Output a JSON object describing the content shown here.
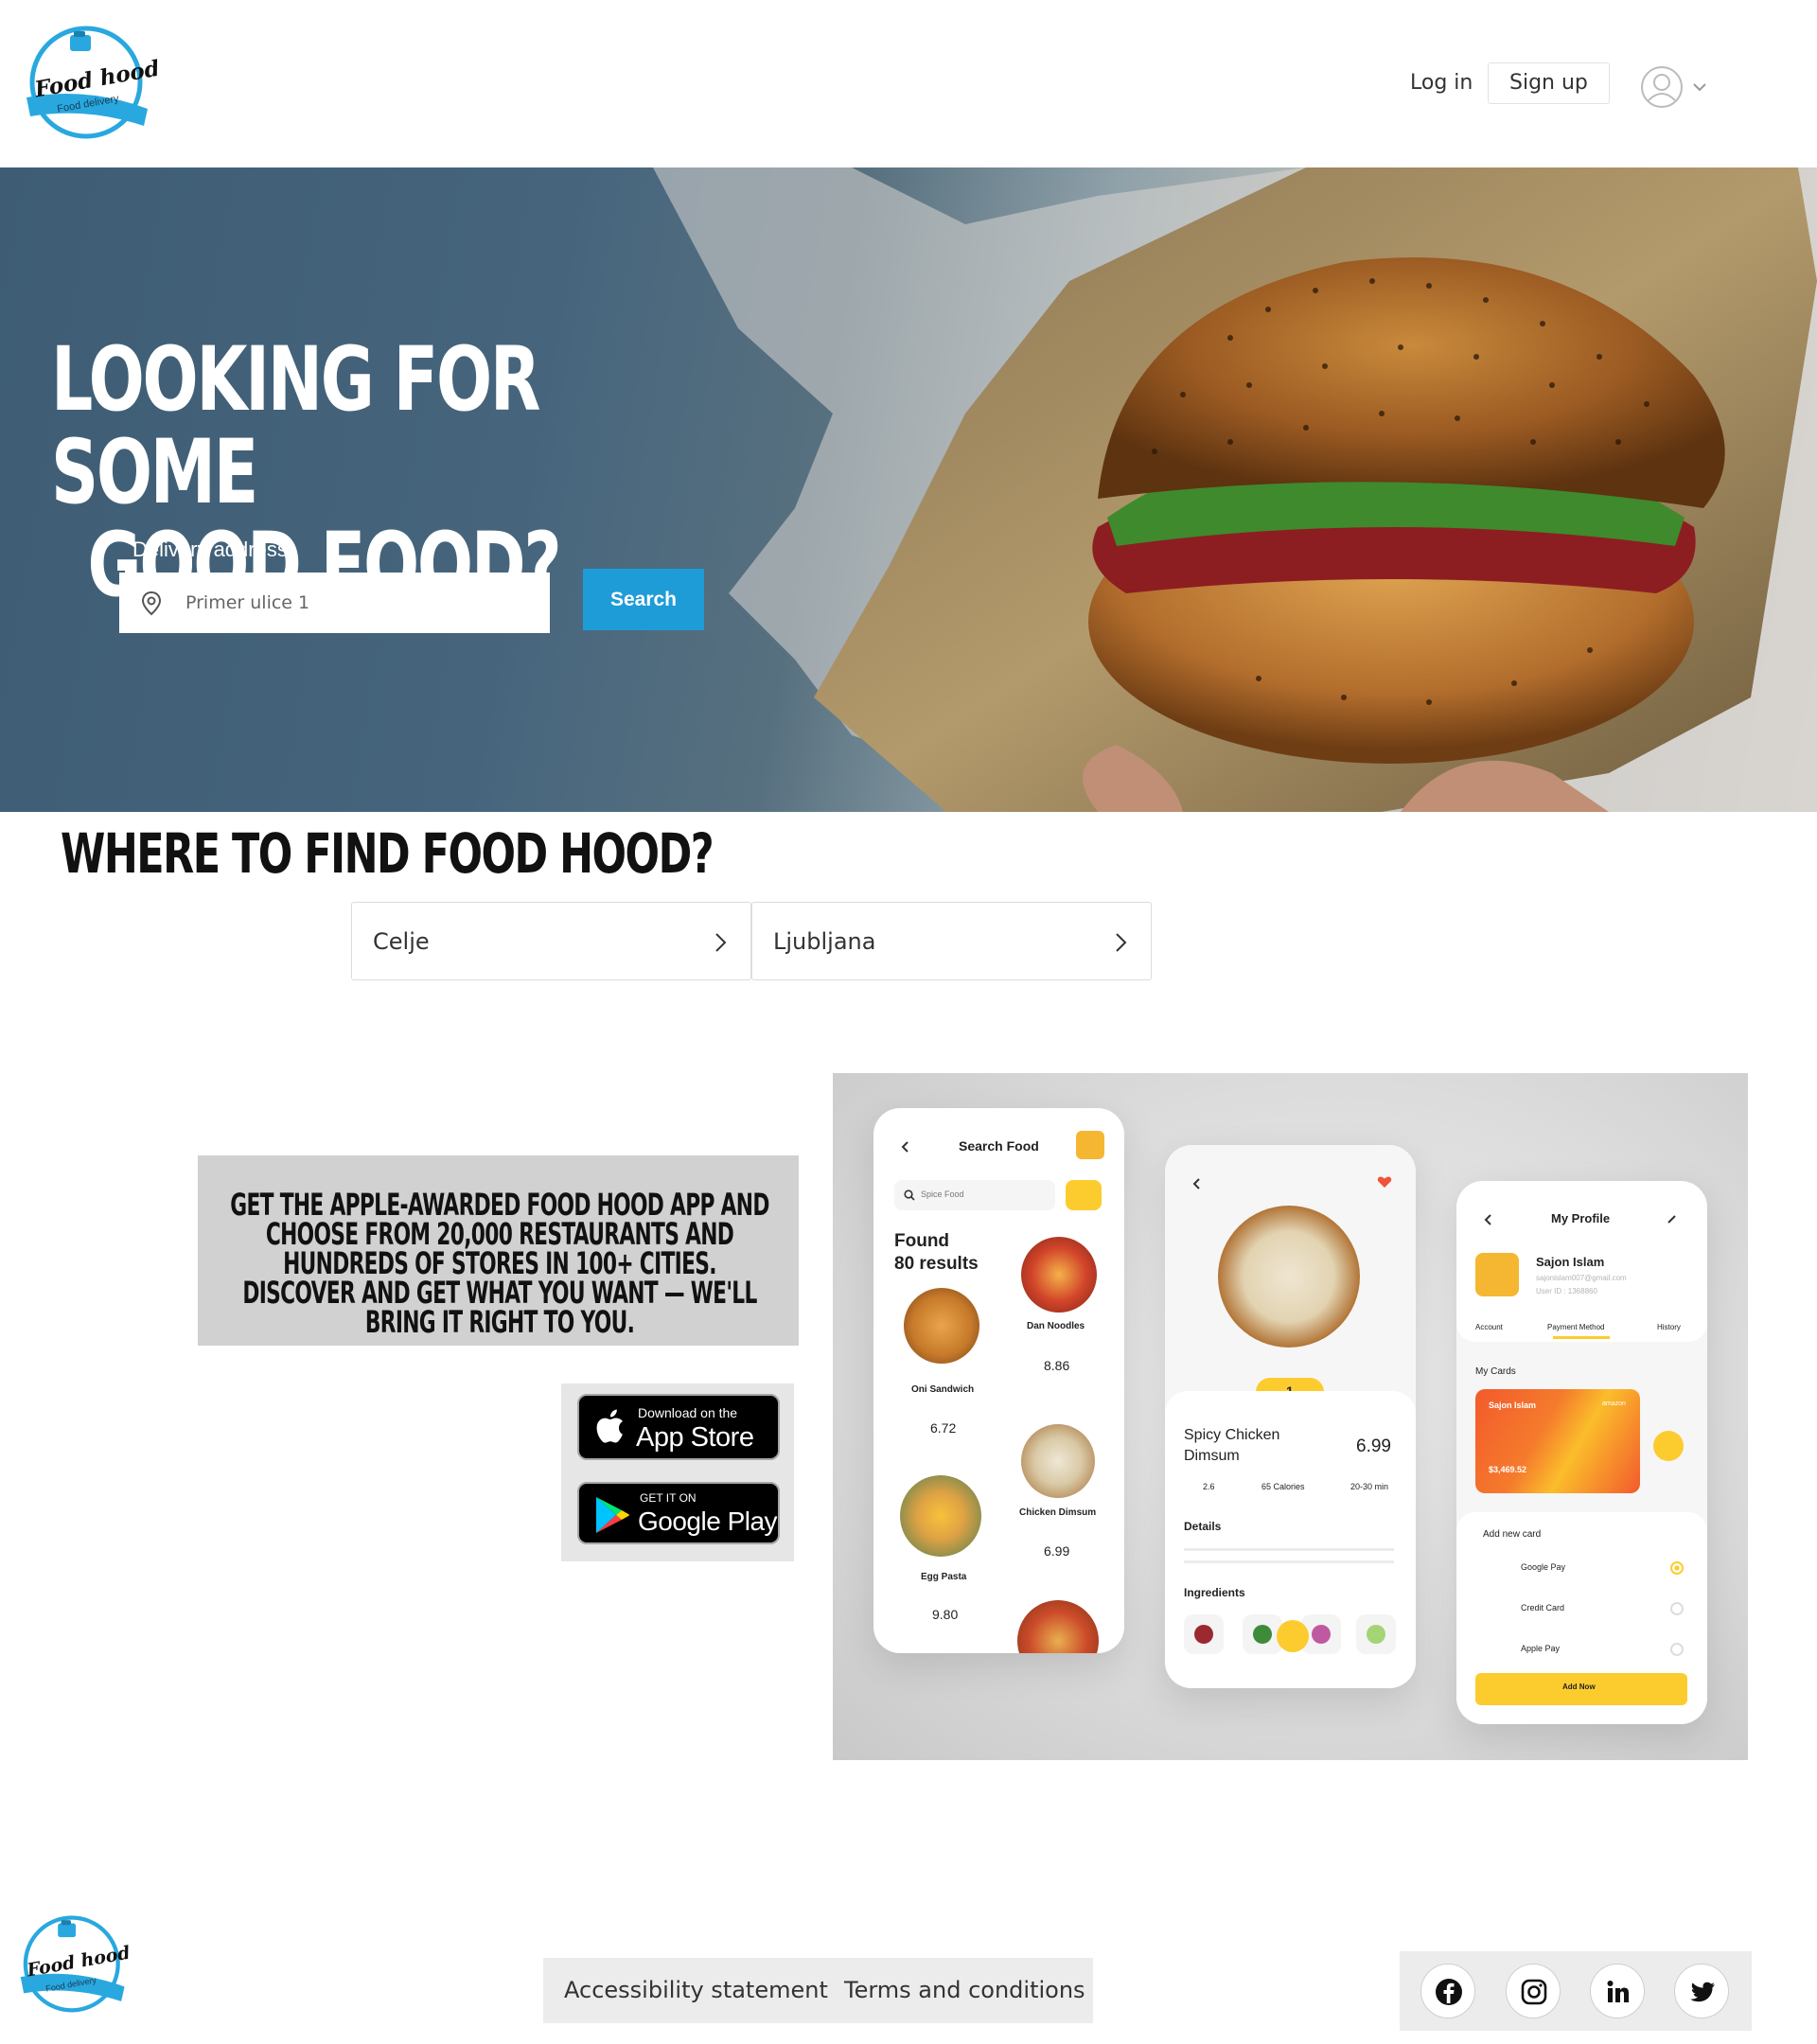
{
  "brand": {
    "logo_title": "Food hood",
    "logo_subtitle": "Food delivery",
    "accent": "#1e9cd8",
    "logo_ring": "#29a8df"
  },
  "header": {
    "login_label": "Log in",
    "signup_label": "Sign up",
    "user_icon": "user-circle-icon",
    "menu_icon": "chevron-down-icon"
  },
  "hero": {
    "title_line1": "Looking for some",
    "title_line2": "good food?",
    "address_label": "Delivery address",
    "address_placeholder": "Primer ulice 1",
    "search_label": "Search",
    "pin_icon": "map-pin-icon"
  },
  "locations": {
    "title": "Where to find Food Hood?",
    "cities": [
      {
        "name": "Celje"
      },
      {
        "name": "Ljubljana"
      }
    ]
  },
  "promo": {
    "text": "Get the Apple-awarded Food Hood app and choose from 20,000 restaurants and hundreds of stores in 100+ cities. Discover and get what you want — we'll bring it right to you.",
    "app_store_small": "Download on the",
    "app_store_big": "App Store",
    "google_small": "GET IT ON",
    "google_big": "Google Play"
  },
  "mockup": {
    "search_screen": {
      "title": "Search Food",
      "search_value": "Spice Food",
      "found_line1": "Found",
      "found_line2": "80 results",
      "items": [
        {
          "name": "Oni Sandwich",
          "price": "6.72"
        },
        {
          "name": "Dan Noodles",
          "price": "8.86"
        },
        {
          "name": "Egg Pasta",
          "price": "9.80"
        },
        {
          "name": "Chicken Dimsum",
          "price": "6.99"
        }
      ]
    },
    "detail_screen": {
      "quantity": "1",
      "name_line1": "Spicy Chicken",
      "name_line2": "Dimsum",
      "price": "6.99",
      "rating": "2.6",
      "calories": "65 Calories",
      "time": "20-30 min",
      "details_label": "Details",
      "ingredients_label": "Ingredients"
    },
    "profile_screen": {
      "title": "My Profile",
      "user_name": "Sajon Islam",
      "user_email": "sajonislam007@gmail.com",
      "user_id": "User ID : 1368860",
      "tabs": [
        "Account",
        "Payment Method",
        "History"
      ],
      "cards_label": "My Cards",
      "card_holder": "Sajon Islam",
      "card_amount": "$3,469.52",
      "card_brand": "amazon",
      "add_card_label": "Add new card",
      "methods": [
        "Google Pay",
        "Credit Card",
        "Apple Pay"
      ],
      "add_button": "Add Now"
    }
  },
  "footer": {
    "accessibility_label": "Accessibility statement",
    "terms_label": "Terms and conditions",
    "socials": [
      "facebook-icon",
      "instagram-icon",
      "linkedin-icon",
      "twitter-icon"
    ]
  }
}
